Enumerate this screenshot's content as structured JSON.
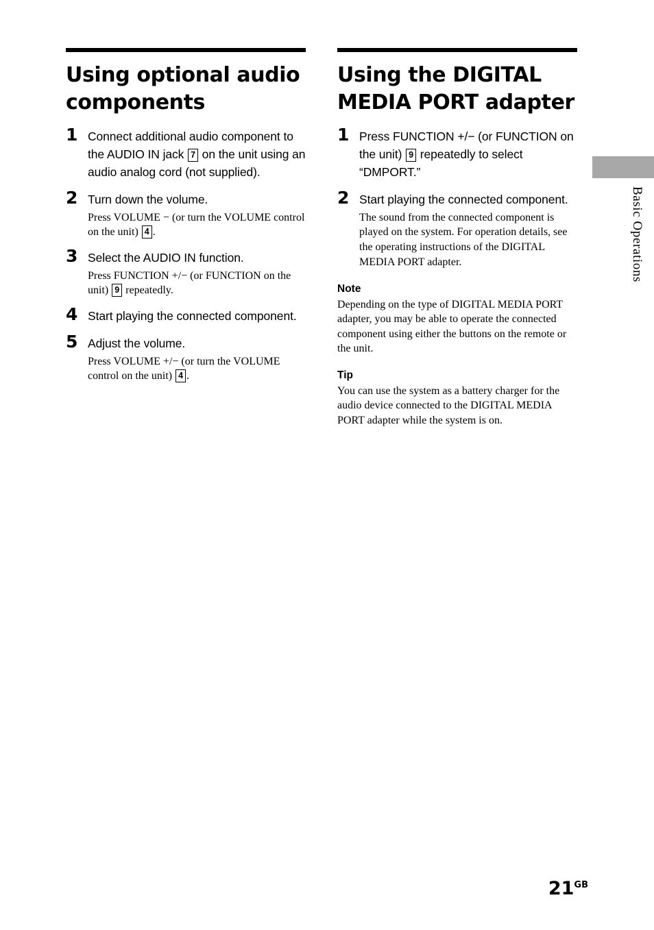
{
  "page": {
    "number": "21",
    "number_suffix": "GB",
    "side_tab_label": "Basic Operations"
  },
  "left_column": {
    "title": "Using optional audio components",
    "steps": [
      {
        "num": "1",
        "head_before": "Connect additional audio component to the AUDIO IN jack ",
        "boxnum": "7",
        "head_after": " on the unit using an audio analog cord (not supplied)."
      },
      {
        "num": "2",
        "head": "Turn down the volume.",
        "body_before": "Press VOLUME − (or turn the VOLUME control on the unit) ",
        "boxnum": "4",
        "body_after": "."
      },
      {
        "num": "3",
        "head": "Select the AUDIO IN function.",
        "body_before": "Press FUNCTION +/− (or FUNCTION on the unit) ",
        "boxnum": "9",
        "body_after": " repeatedly."
      },
      {
        "num": "4",
        "head": "Start playing the connected component."
      },
      {
        "num": "5",
        "head": "Adjust the volume.",
        "body_before": "Press VOLUME +/− (or turn the VOLUME control on the unit) ",
        "boxnum": "4",
        "body_after": "."
      }
    ]
  },
  "right_column": {
    "title": "Using the DIGITAL MEDIA PORT adapter",
    "steps": [
      {
        "num": "1",
        "head_before": "Press FUNCTION +/− (or FUNCTION on the unit) ",
        "boxnum": "9",
        "head_after": " repeatedly to select “DMPORT.”"
      },
      {
        "num": "2",
        "head": "Start playing the connected component.",
        "body": "The sound from the connected component is played on the system. For operation details, see the operating instructions of the DIGITAL MEDIA PORT adapter."
      }
    ],
    "note": {
      "heading": "Note",
      "text": "Depending on the type of DIGITAL MEDIA PORT adapter, you may be able to operate the connected component using either the buttons on the remote or the unit."
    },
    "tip": {
      "heading": "Tip",
      "text": "You can use the system as a battery charger for the audio device connected to the DIGITAL MEDIA PORT adapter while the system is on."
    }
  }
}
